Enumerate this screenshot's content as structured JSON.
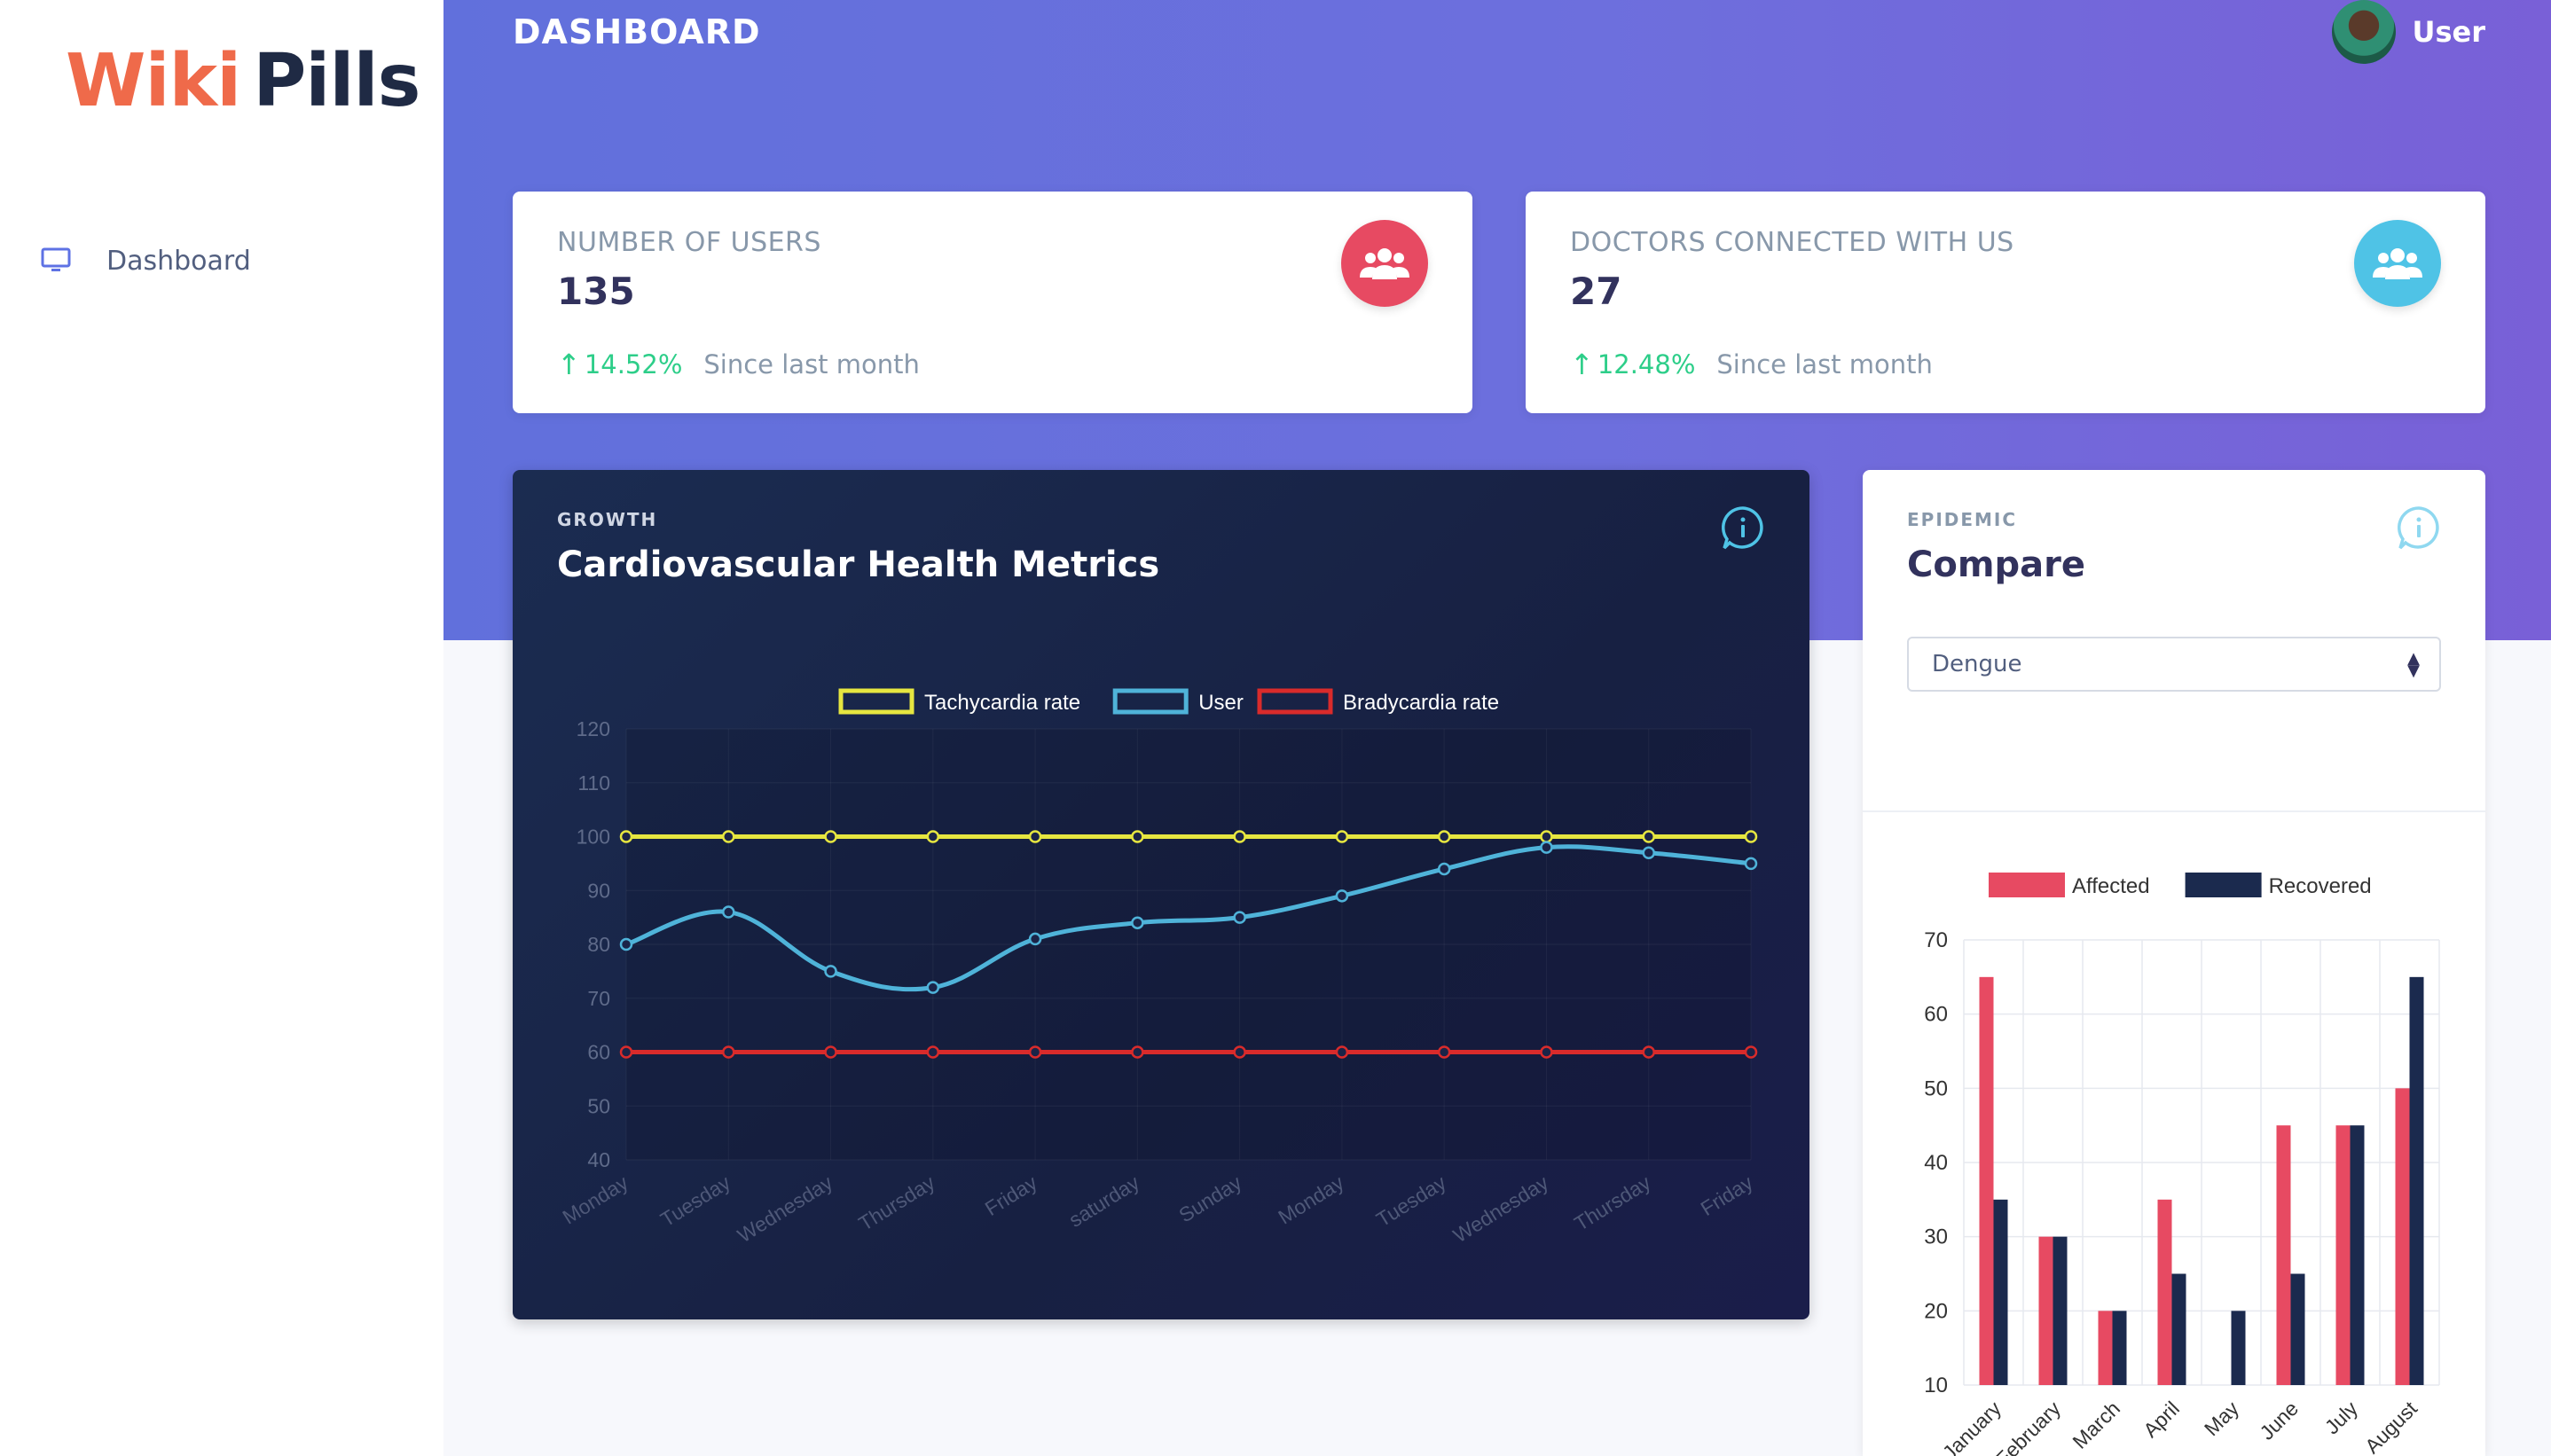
{
  "brand": {
    "part1": "Wiki",
    "part2": "Pills"
  },
  "sidebar": {
    "items": [
      {
        "label": "Dashboard",
        "icon": "monitor-icon"
      }
    ]
  },
  "header": {
    "title": "DASHBOARD",
    "user_name": "User"
  },
  "stats": [
    {
      "title": "NUMBER OF USERS",
      "value": "135",
      "change": "14.52%",
      "since": "Since last month",
      "icon": "users-icon",
      "color": "#e74a62"
    },
    {
      "title": "DOCTORS CONNECTED WITH US",
      "value": "27",
      "change": "12.48%",
      "since": "Since last month",
      "icon": "users-icon",
      "color": "#4fc3e6"
    }
  ],
  "growth": {
    "subtitle": "GROWTH",
    "title": "Cardiovascular Health Metrics",
    "icon": "info-icon"
  },
  "compare": {
    "subtitle": "EPIDEMIC",
    "title": "Compare",
    "select_value": "Dengue",
    "icon": "info-icon"
  },
  "colors": {
    "tachy": "#e6e640",
    "user": "#4fb3d9",
    "brady": "#d92b2b",
    "affected": "#e74a62",
    "recovered": "#1b2a4e"
  },
  "chart_data": [
    {
      "type": "line",
      "categories": [
        "Monday",
        "Tuesday",
        "Wednesday",
        "Thursday",
        "Friday",
        "saturday",
        "Sunday",
        "Monday",
        "Tuesday",
        "Wednesday",
        "Thursday",
        "Friday"
      ],
      "series": [
        {
          "name": "Tachycardia rate",
          "values": [
            100,
            100,
            100,
            100,
            100,
            100,
            100,
            100,
            100,
            100,
            100,
            100
          ]
        },
        {
          "name": "User",
          "values": [
            80,
            86,
            75,
            72,
            81,
            84,
            85,
            89,
            94,
            98,
            97,
            95
          ]
        },
        {
          "name": "Bradycardia rate",
          "values": [
            60,
            60,
            60,
            60,
            60,
            60,
            60,
            60,
            60,
            60,
            60,
            60
          ]
        }
      ],
      "ylim": [
        40,
        120
      ],
      "yticks": [
        "120",
        "110",
        "100",
        "90",
        "80",
        "70",
        "60",
        "50",
        "40"
      ],
      "legend": "top",
      "grid": true
    },
    {
      "type": "bar",
      "categories": [
        "January",
        "February",
        "March",
        "April",
        "May",
        "June",
        "July",
        "August"
      ],
      "series": [
        {
          "name": "Affected",
          "values": [
            65,
            30,
            20,
            35,
            10,
            45,
            45,
            50
          ]
        },
        {
          "name": "Recovered",
          "values": [
            35,
            30,
            20,
            25,
            20,
            25,
            45,
            65
          ]
        }
      ],
      "ylim": [
        10,
        70
      ],
      "yticks": [
        "70",
        "60",
        "50",
        "40",
        "30",
        "20",
        "10"
      ],
      "legend": "top",
      "grid": true
    }
  ]
}
